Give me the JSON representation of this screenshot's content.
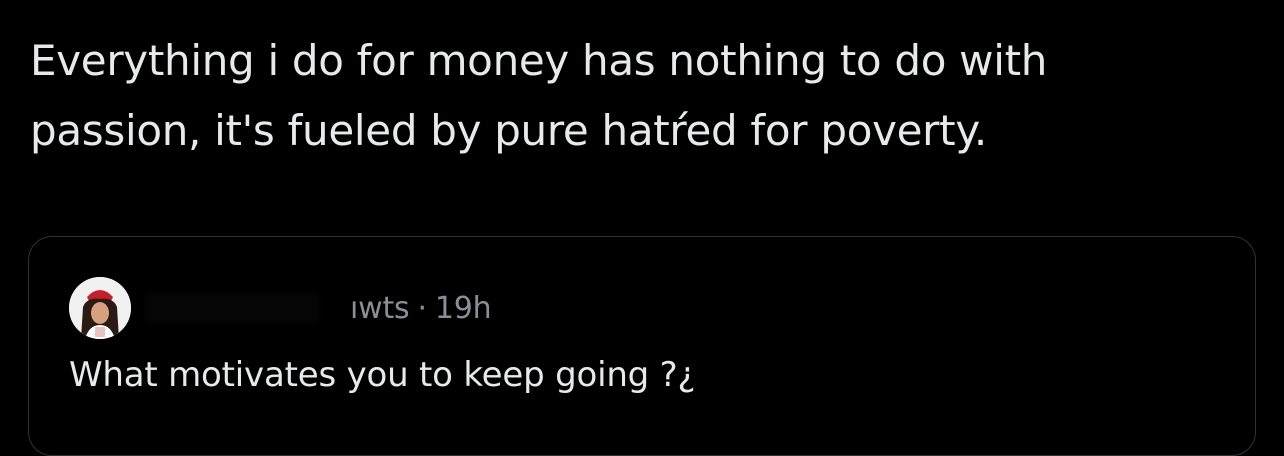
{
  "tweet": {
    "text": "Everything i do for money has nothing to do with\npassion, it's fueled by pure hatŕed for poverty."
  },
  "quote": {
    "handle_fragment": "ıwts",
    "separator": "·",
    "time": "19h",
    "text": "What motivates you to keep going ?¿"
  },
  "colors": {
    "background": "#000000",
    "text_primary": "#e7e9ea",
    "text_secondary": "#8b8f94",
    "card_border": "#2f3336"
  },
  "icons": {
    "avatar": "profile-avatar"
  }
}
